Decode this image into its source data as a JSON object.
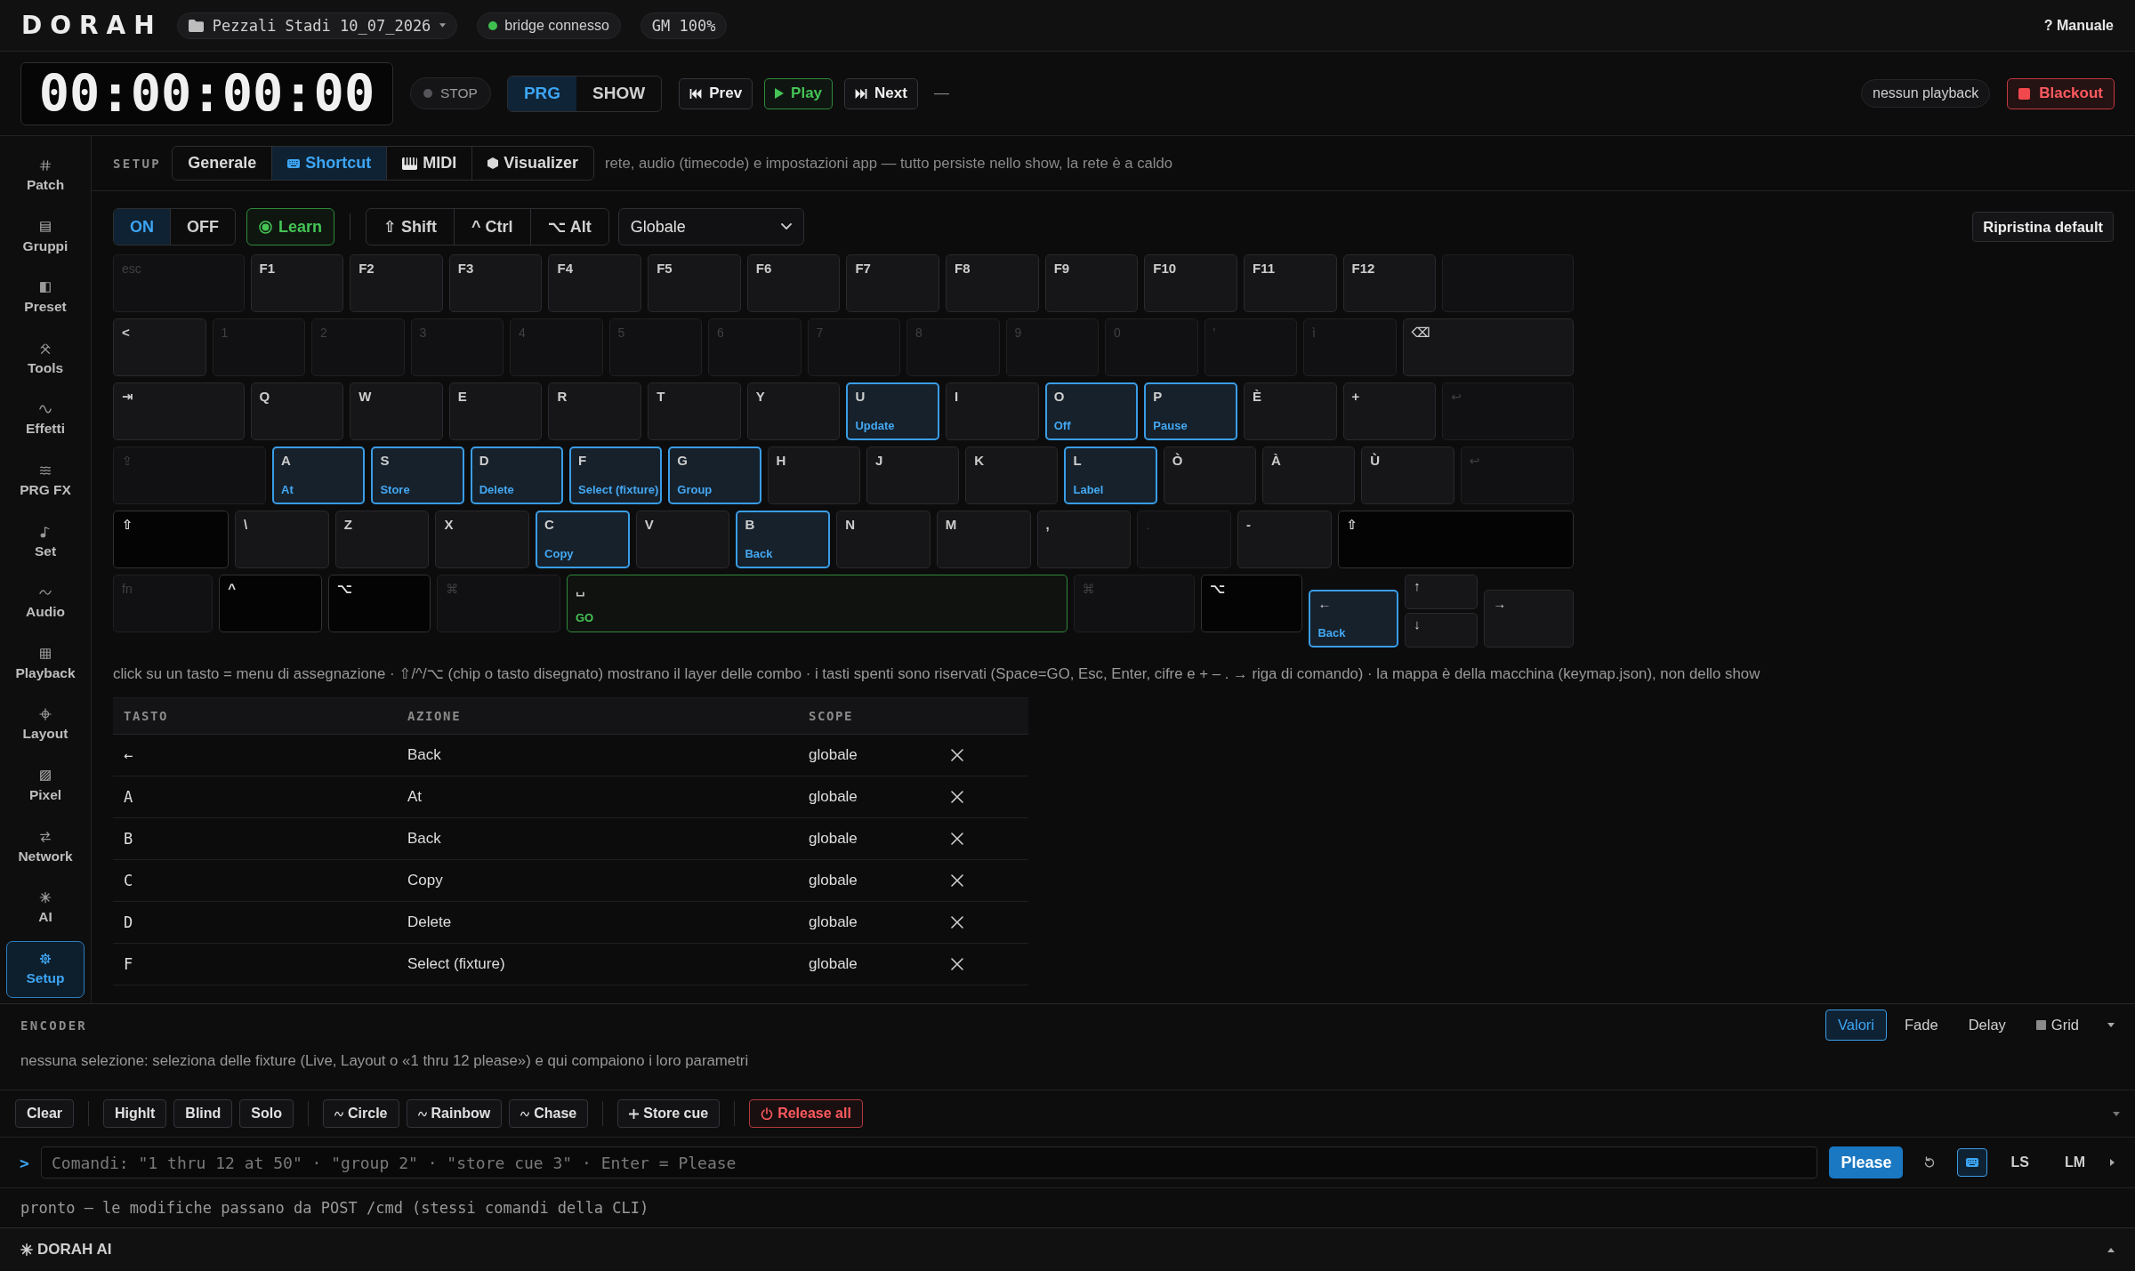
{
  "topbar": {
    "logo": "DORAH",
    "project": "Pezzali Stadi 10_07_2026",
    "bridge": {
      "label": "bridge connesso",
      "connected": true
    },
    "master": "GM 100%",
    "help": "? Manuale"
  },
  "transport": {
    "timecode": "00:00:00:00",
    "state": {
      "label": "STOP",
      "running": false
    },
    "modes": [
      {
        "label": "PRG",
        "selected": true
      },
      {
        "label": "SHOW",
        "selected": false
      }
    ],
    "buttons": [
      {
        "label": "Prev",
        "kind": "prev"
      },
      {
        "label": "Play",
        "kind": "play"
      },
      {
        "label": "Next",
        "kind": "next"
      }
    ],
    "cue": "—",
    "playback": "nessun playback",
    "blackout": "Blackout"
  },
  "sidebar": {
    "items": [
      {
        "label": "Patch",
        "selected": false
      },
      {
        "label": "Gruppi",
        "selected": false
      },
      {
        "label": "Preset",
        "selected": false
      },
      {
        "label": "Tools",
        "selected": false
      },
      {
        "label": "Effetti",
        "selected": false
      },
      {
        "label": "PRG FX",
        "selected": false
      },
      {
        "label": "Set",
        "selected": false
      },
      {
        "label": "Audio",
        "selected": false
      },
      {
        "label": "Playback",
        "selected": false
      },
      {
        "label": "Layout",
        "selected": false
      },
      {
        "label": "Pixel",
        "selected": false
      },
      {
        "label": "Network",
        "selected": false
      },
      {
        "label": "AI",
        "selected": false
      },
      {
        "label": "Setup",
        "selected": true
      }
    ]
  },
  "setup": {
    "title": "SETUP",
    "tabs": [
      {
        "label": "Generale",
        "selected": false
      },
      {
        "label": "Shortcut",
        "selected": true
      },
      {
        "label": "MIDI",
        "selected": false
      },
      {
        "label": "Visualizer",
        "selected": false
      }
    ],
    "description": "rete, audio (timecode) e impostazioni app — tutto persiste nello show, la rete è a caldo"
  },
  "shortcut": {
    "enabled": [
      {
        "label": "ON",
        "selected": true
      },
      {
        "label": "OFF",
        "selected": false
      }
    ],
    "learn": {
      "label": "Learn",
      "on": true
    },
    "modifiers": [
      {
        "label": "⇧ Shift",
        "on": false
      },
      {
        "label": "^ Ctrl",
        "on": false
      },
      {
        "label": "⌥ Alt",
        "on": false
      }
    ],
    "scope": "Globale",
    "reset": "Ripristina default",
    "keyboard": {
      "rows": [
        [
          {
            "label": "esc",
            "kind": "reserved"
          },
          {
            "label": "F1",
            "kind": "free"
          },
          {
            "label": "F2",
            "kind": "free"
          },
          {
            "label": "F3",
            "kind": "free"
          },
          {
            "label": "F4",
            "kind": "free"
          },
          {
            "label": "F5",
            "kind": "free"
          },
          {
            "label": "F6",
            "kind": "free"
          },
          {
            "label": "F7",
            "kind": "free"
          },
          {
            "label": "F8",
            "kind": "free"
          },
          {
            "label": "F9",
            "kind": "free"
          },
          {
            "label": "F10",
            "kind": "free"
          },
          {
            "label": "F11",
            "kind": "free"
          },
          {
            "label": "F12",
            "kind": "free"
          },
          {
            "kind": "reserved"
          }
        ],
        [
          {
            "label": "<",
            "kind": "free"
          },
          {
            "label": "1",
            "kind": "reserved"
          },
          {
            "label": "2",
            "kind": "reserved"
          },
          {
            "label": "3",
            "kind": "reserved"
          },
          {
            "label": "4",
            "kind": "reserved"
          },
          {
            "label": "5",
            "kind": "reserved"
          },
          {
            "label": "6",
            "kind": "reserved"
          },
          {
            "label": "7",
            "kind": "reserved"
          },
          {
            "label": "8",
            "kind": "reserved"
          },
          {
            "label": "9",
            "kind": "reserved"
          },
          {
            "label": "0",
            "kind": "reserved"
          },
          {
            "label": "'",
            "kind": "reserved"
          },
          {
            "label": "ì",
            "kind": "reserved"
          },
          {
            "label": "⌫",
            "kind": "free"
          }
        ],
        [
          {
            "label": "⇥",
            "kind": "free"
          },
          {
            "label": "Q",
            "kind": "free"
          },
          {
            "label": "W",
            "kind": "free"
          },
          {
            "label": "E",
            "kind": "free"
          },
          {
            "label": "R",
            "kind": "free"
          },
          {
            "label": "T",
            "kind": "free"
          },
          {
            "label": "Y",
            "kind": "free"
          },
          {
            "label": "U",
            "kind": "assigned",
            "action": "Update"
          },
          {
            "label": "I",
            "kind": "free"
          },
          {
            "label": "O",
            "kind": "assigned",
            "action": "Off"
          },
          {
            "label": "P",
            "kind": "assigned",
            "action": "Pause"
          },
          {
            "label": "È",
            "kind": "free"
          },
          {
            "label": "+",
            "kind": "free"
          },
          {
            "label": "↩",
            "kind": "reserved"
          }
        ],
        [
          {
            "label": "⇪",
            "kind": "reserved"
          },
          {
            "label": "A",
            "kind": "assigned",
            "action": "At"
          },
          {
            "label": "S",
            "kind": "assigned",
            "action": "Store"
          },
          {
            "label": "D",
            "kind": "assigned",
            "action": "Delete"
          },
          {
            "label": "F",
            "kind": "assigned",
            "action": "Select (fixture)"
          },
          {
            "label": "G",
            "kind": "assigned",
            "action": "Group"
          },
          {
            "label": "H",
            "kind": "free"
          },
          {
            "label": "J",
            "kind": "free"
          },
          {
            "label": "K",
            "kind": "free"
          },
          {
            "label": "L",
            "kind": "assigned",
            "action": "Label"
          },
          {
            "label": "Ò",
            "kind": "free"
          },
          {
            "label": "À",
            "kind": "free"
          },
          {
            "label": "Ù",
            "kind": "free"
          },
          {
            "label": "↩",
            "kind": "reserved"
          }
        ],
        [
          {
            "label": "⇧",
            "kind": "modifier"
          },
          {
            "label": "\\",
            "kind": "free"
          },
          {
            "label": "Z",
            "kind": "free"
          },
          {
            "label": "X",
            "kind": "free"
          },
          {
            "label": "C",
            "kind": "assigned",
            "action": "Copy"
          },
          {
            "label": "V",
            "kind": "free"
          },
          {
            "label": "B",
            "kind": "assigned",
            "action": "Back"
          },
          {
            "label": "N",
            "kind": "free"
          },
          {
            "label": "M",
            "kind": "free"
          },
          {
            "label": ",",
            "kind": "free"
          },
          {
            "label": ".",
            "kind": "reserved"
          },
          {
            "label": "-",
            "kind": "free"
          },
          {
            "label": "⇧",
            "kind": "modifier"
          }
        ],
        [
          {
            "label": "fn",
            "kind": "reserved"
          },
          {
            "label": "^",
            "kind": "modifier"
          },
          {
            "label": "⌥",
            "kind": "modifier"
          },
          {
            "label": "⌘",
            "kind": "reserved"
          },
          {
            "label": "␣",
            "kind": "go",
            "action": "GO"
          },
          {
            "label": "⌘",
            "kind": "reserved"
          },
          {
            "label": "⌥",
            "kind": "modifier"
          },
          {
            "label": "←",
            "kind": "assigned",
            "action": "Back"
          },
          {
            "stack": [
              {
                "label": "↑",
                "kind": "free"
              },
              {
                "label": "↓",
                "kind": "free"
              }
            ]
          },
          {
            "label": "→",
            "kind": "free"
          }
        ]
      ]
    },
    "hint": "click su un tasto = menu di assegnazione · ⇧/^/⌥ (chip o tasto disegnato) mostrano il layer delle combo · i tasti spenti sono riservati (Space=GO, Esc, Enter, cifre e + – . → riga di comando) · la mappa è della macchina (keymap.json), non dello show",
    "table": {
      "columns": [
        "TASTO",
        "AZIONE",
        "SCOPE"
      ],
      "rows": [
        {
          "key": "←",
          "action": "Back",
          "scope": "globale"
        },
        {
          "key": "A",
          "action": "At",
          "scope": "globale"
        },
        {
          "key": "B",
          "action": "Back",
          "scope": "globale"
        },
        {
          "key": "C",
          "action": "Copy",
          "scope": "globale"
        },
        {
          "key": "D",
          "action": "Delete",
          "scope": "globale"
        },
        {
          "key": "F",
          "action": "Select (fixture)",
          "scope": "globale"
        }
      ]
    }
  },
  "encoder": {
    "title": "ENCODER",
    "expanded": true,
    "views": [
      {
        "label": "Valori",
        "selected": true
      },
      {
        "label": "Fade",
        "selected": false
      },
      {
        "label": "Delay",
        "selected": false
      },
      {
        "label": "Grid",
        "selected": false
      }
    ],
    "message": "nessuna selezione: seleziona delle fixture (Live, Layout o «1 thru 12 please») e qui compaiono i loro parametri"
  },
  "actions": {
    "expanded": true,
    "groups": [
      [
        {
          "label": "Clear",
          "kind": "plain"
        }
      ],
      [
        {
          "label": "Highlt",
          "kind": "plain"
        },
        {
          "label": "Blind",
          "kind": "plain"
        },
        {
          "label": "Solo",
          "kind": "plain"
        }
      ],
      [
        {
          "label": "Circle",
          "kind": "effect"
        },
        {
          "label": "Rainbow",
          "kind": "effect"
        },
        {
          "label": "Chase",
          "kind": "effect"
        }
      ],
      [
        {
          "label": "Store cue",
          "kind": "add"
        }
      ],
      [
        {
          "label": "Release all",
          "kind": "danger"
        }
      ]
    ]
  },
  "command": {
    "prompt": ">",
    "placeholder": "Comandi: \"1 thru 12 at 50\" · \"group 2\" · \"store cue 3\" · Enter = Please",
    "submit": "Please",
    "keypad": {
      "on": true
    },
    "modes": [
      "LS",
      "LM"
    ]
  },
  "status": "pronto — le modifiche passano da POST /cmd (stessi comandi della CLI)",
  "ai": {
    "title": "DORAH AI",
    "expanded": false
  }
}
